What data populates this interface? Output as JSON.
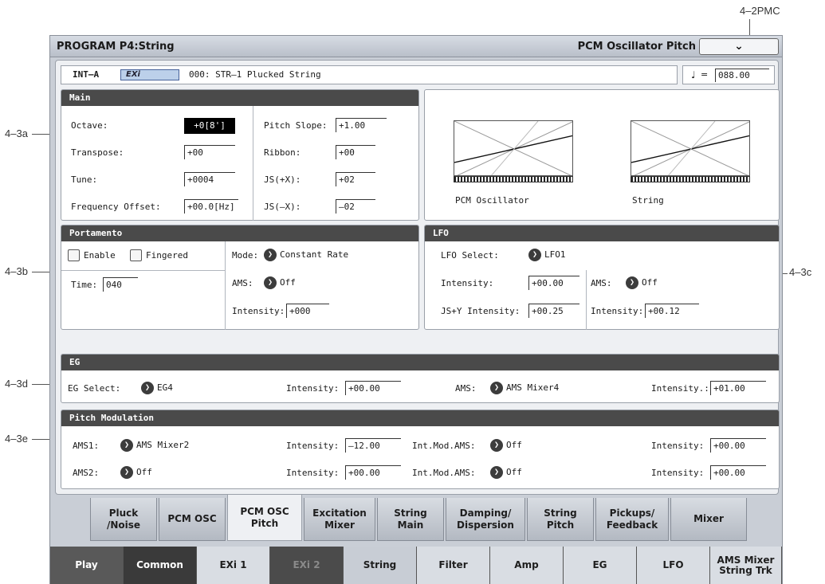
{
  "callouts": {
    "top": "4–2PMC",
    "a": "4–3a",
    "b": "4–3b",
    "c": "4–3c",
    "d": "4–3d",
    "e": "4–3e"
  },
  "title_bar": {
    "title": "PROGRAM P4:String",
    "page_name": "PCM Oscillator Pitch",
    "menu_symbol": "⌄"
  },
  "program": {
    "bank": "INT–A",
    "exi_badge": "EXi",
    "name": "000: STR–1 Plucked String"
  },
  "tempo": {
    "symbol": "♩",
    "eq": "=",
    "value": "088.00"
  },
  "main": {
    "header": "Main",
    "octave_label": "Octave:",
    "octave_value": "+0[8']",
    "transpose_label": "Transpose:",
    "transpose_value": "+00",
    "tune_label": "Tune:",
    "tune_value": "+0004",
    "freq_label": "Frequency Offset:",
    "freq_value": "+00.0[Hz]",
    "pitch_slope_label": "Pitch Slope:",
    "pitch_slope_value": "+1.00",
    "ribbon_label": "Ribbon:",
    "ribbon_value": "+00",
    "jsx_pos_label": "JS(+X):",
    "jsx_pos_value": "+02",
    "jsx_neg_label": "JS(–X):",
    "jsx_neg_value": "–02"
  },
  "graphs": {
    "pcm_label": "PCM Oscillator",
    "string_label": "String"
  },
  "portamento": {
    "header": "Portamento",
    "enable_label": "Enable",
    "fingered_label": "Fingered",
    "mode_label": "Mode:",
    "mode_value": "Constant Rate",
    "time_label": "Time:",
    "time_value": "040",
    "ams_label": "AMS:",
    "ams_value": "Off",
    "intensity_label": "Intensity:",
    "intensity_value": "+000"
  },
  "lfo": {
    "header": "LFO",
    "select_label": "LFO Select:",
    "select_value": "LFO1",
    "intensity_label": "Intensity:",
    "intensity_value": "+00.00",
    "ams_label": "AMS:",
    "ams_value": "Off",
    "js_label": "JS+Y Intensity:",
    "js_value": "+00.25",
    "ams_int_label": "Intensity:",
    "ams_int_value": "+00.12"
  },
  "eg": {
    "header": "EG",
    "select_label": "EG Select:",
    "select_value": "EG4",
    "intensity_label": "Intensity:",
    "intensity_value": "+00.00",
    "ams_label": "AMS:",
    "ams_value": "AMS Mixer4",
    "ams_int_label": "Intensity.:",
    "ams_int_value": "+01.00"
  },
  "pitch_mod": {
    "header": "Pitch Modulation",
    "rows": [
      {
        "ams_label": "AMS1:",
        "ams_value": "AMS Mixer2",
        "int_label": "Intensity:",
        "int_value": "–12.00",
        "mod_label": "Int.Mod.AMS:",
        "mod_value": "Off",
        "int2_label": "Intensity:",
        "int2_value": "+00.00"
      },
      {
        "ams_label": "AMS2:",
        "ams_value": "Off",
        "int_label": "Intensity:",
        "int_value": "+00.00",
        "mod_label": "Int.Mod.AMS:",
        "mod_value": "Off",
        "int2_label": "Intensity:",
        "int2_value": "+00.00"
      }
    ]
  },
  "sub_tabs": [
    "Pluck\n/Noise",
    "PCM OSC",
    "PCM OSC\nPitch",
    "Excitation\nMixer",
    "String\nMain",
    "Damping/\nDispersion",
    "String\nPitch",
    "Pickups/\nFeedback",
    "Mixer"
  ],
  "main_tabs": [
    "Play",
    "Common",
    "EXi 1",
    "EXi 2",
    "String",
    "Filter",
    "Amp",
    "EG",
    "LFO",
    "AMS Mixer\nString Trk"
  ]
}
